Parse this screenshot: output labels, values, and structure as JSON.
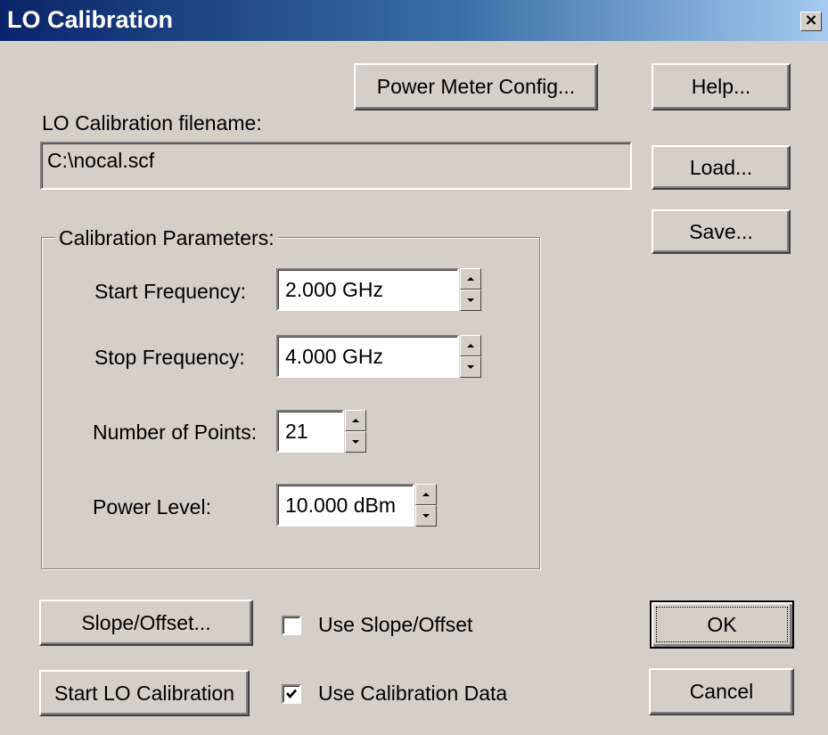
{
  "window": {
    "title": "LO Calibration",
    "close_glyph": "×"
  },
  "buttons": {
    "power_meter_config": "Power Meter Config...",
    "help": "Help...",
    "load": "Load...",
    "save": "Save...",
    "slope_offset": "Slope/Offset...",
    "start_lo_calibration": "Start LO Calibration",
    "ok": "OK",
    "cancel": "Cancel"
  },
  "filename": {
    "label": "LO Calibration filename:",
    "value": "C:\\nocal.scf"
  },
  "calibration_parameters": {
    "legend": "Calibration Parameters:",
    "start_frequency": {
      "label": "Start Frequency:",
      "value": "2.000 GHz"
    },
    "stop_frequency": {
      "label": "Stop Frequency:",
      "value": "4.000 GHz"
    },
    "number_of_points": {
      "label": "Number of Points:",
      "value": "21"
    },
    "power_level": {
      "label": "Power Level:",
      "value": "10.000 dBm"
    }
  },
  "options": {
    "use_slope_offset": {
      "label": "Use Slope/Offset",
      "checked": false
    },
    "use_calibration_data": {
      "label": "Use Calibration Data",
      "checked": true
    }
  },
  "icons": {
    "close": "close-icon",
    "spin_up": "spin-up-icon",
    "spin_down": "spin-down-icon",
    "checkmark": "checkmark-icon"
  },
  "colors": {
    "titlebar_start": "#0a246a",
    "titlebar_end": "#a6caf0",
    "face": "#d4d0c8"
  }
}
